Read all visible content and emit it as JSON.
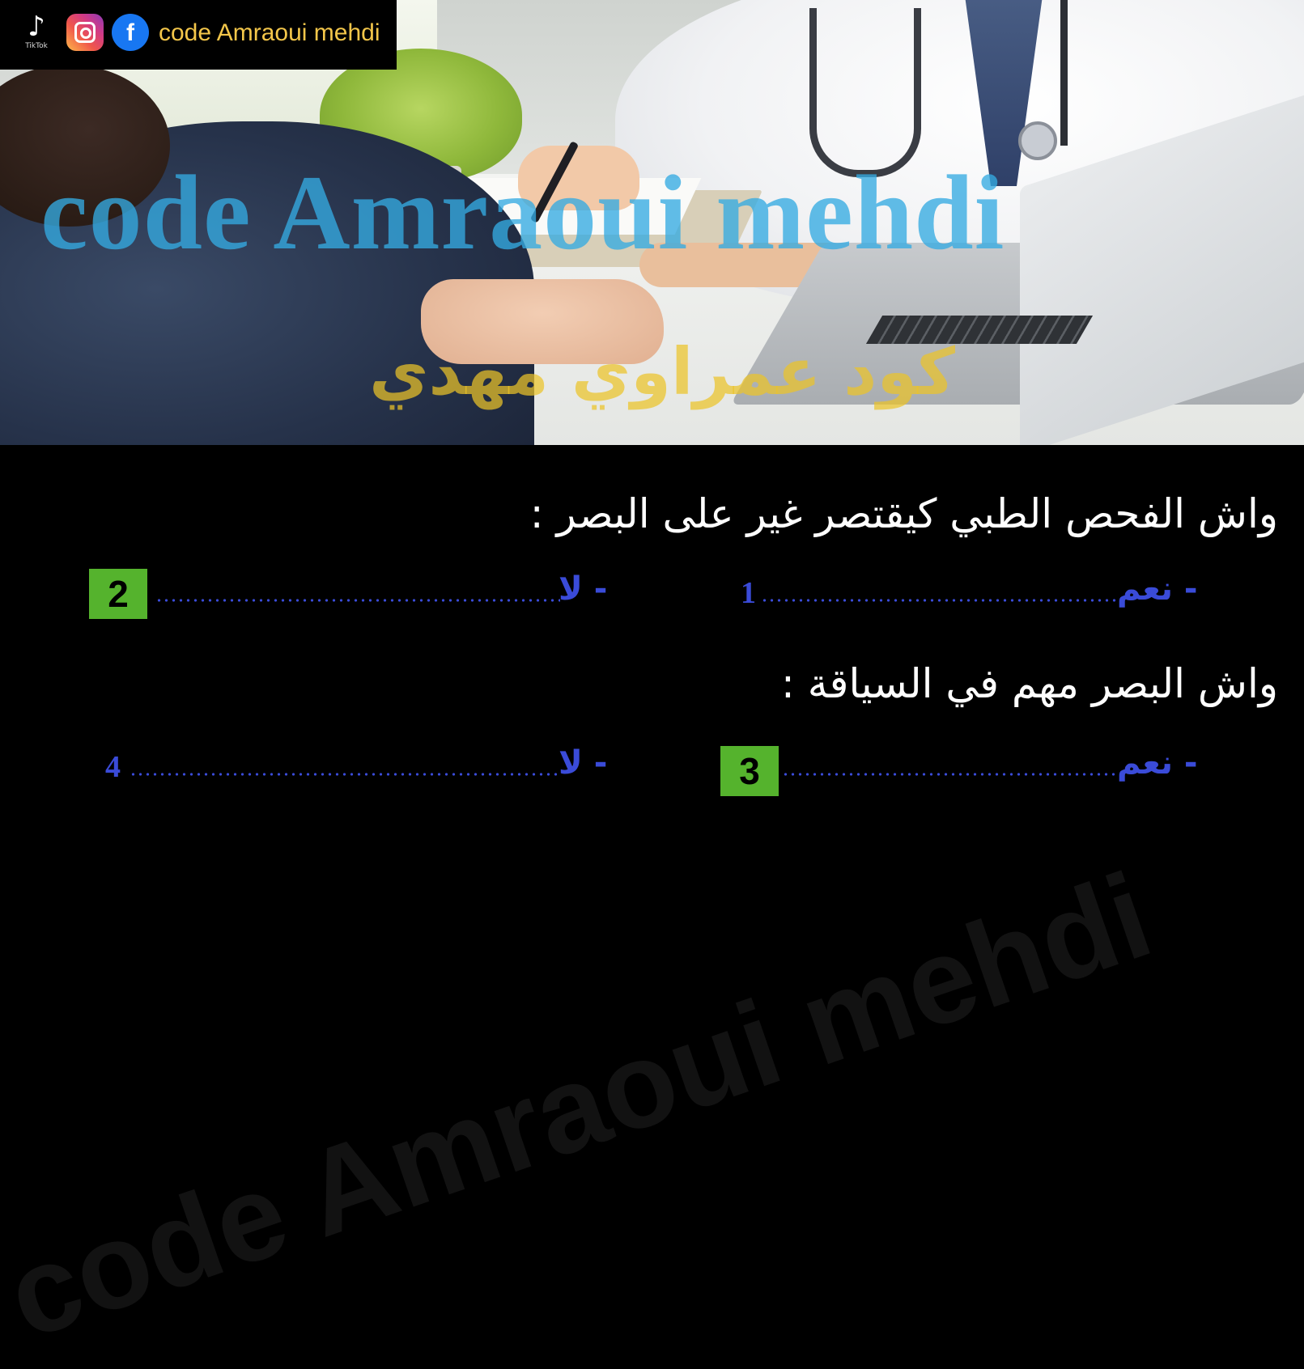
{
  "social": {
    "tiktok_icon": "tiktok-icon",
    "tiktok_label": "TikTok",
    "instagram_icon": "instagram-icon",
    "facebook_icon": "facebook-icon",
    "facebook_glyph": "f",
    "handle": "code Amraoui mehdi"
  },
  "watermark": {
    "latin": "code Amraoui mehdi",
    "arabic": "كود عمراوي مهدي",
    "latin_color": "#34aae1",
    "arabic_color": "#ecc428"
  },
  "questions": [
    {
      "text": "واش الفحص الطبي كيقتصر غير على البصر :",
      "options": [
        {
          "label": "- نعم",
          "number": "1",
          "highlighted": false
        },
        {
          "label": "- لا",
          "number": "2",
          "highlighted": true
        }
      ]
    },
    {
      "text": "واش البصر مهم في السياقة :",
      "options": [
        {
          "label": "- نعم",
          "number": "3",
          "highlighted": true
        },
        {
          "label": "- لا",
          "number": "4",
          "highlighted": false
        }
      ]
    }
  ],
  "colors": {
    "option_text": "#3a4bd8",
    "highlight_box": "#55b32d",
    "question_text": "#ffffff",
    "background": "#000000"
  }
}
